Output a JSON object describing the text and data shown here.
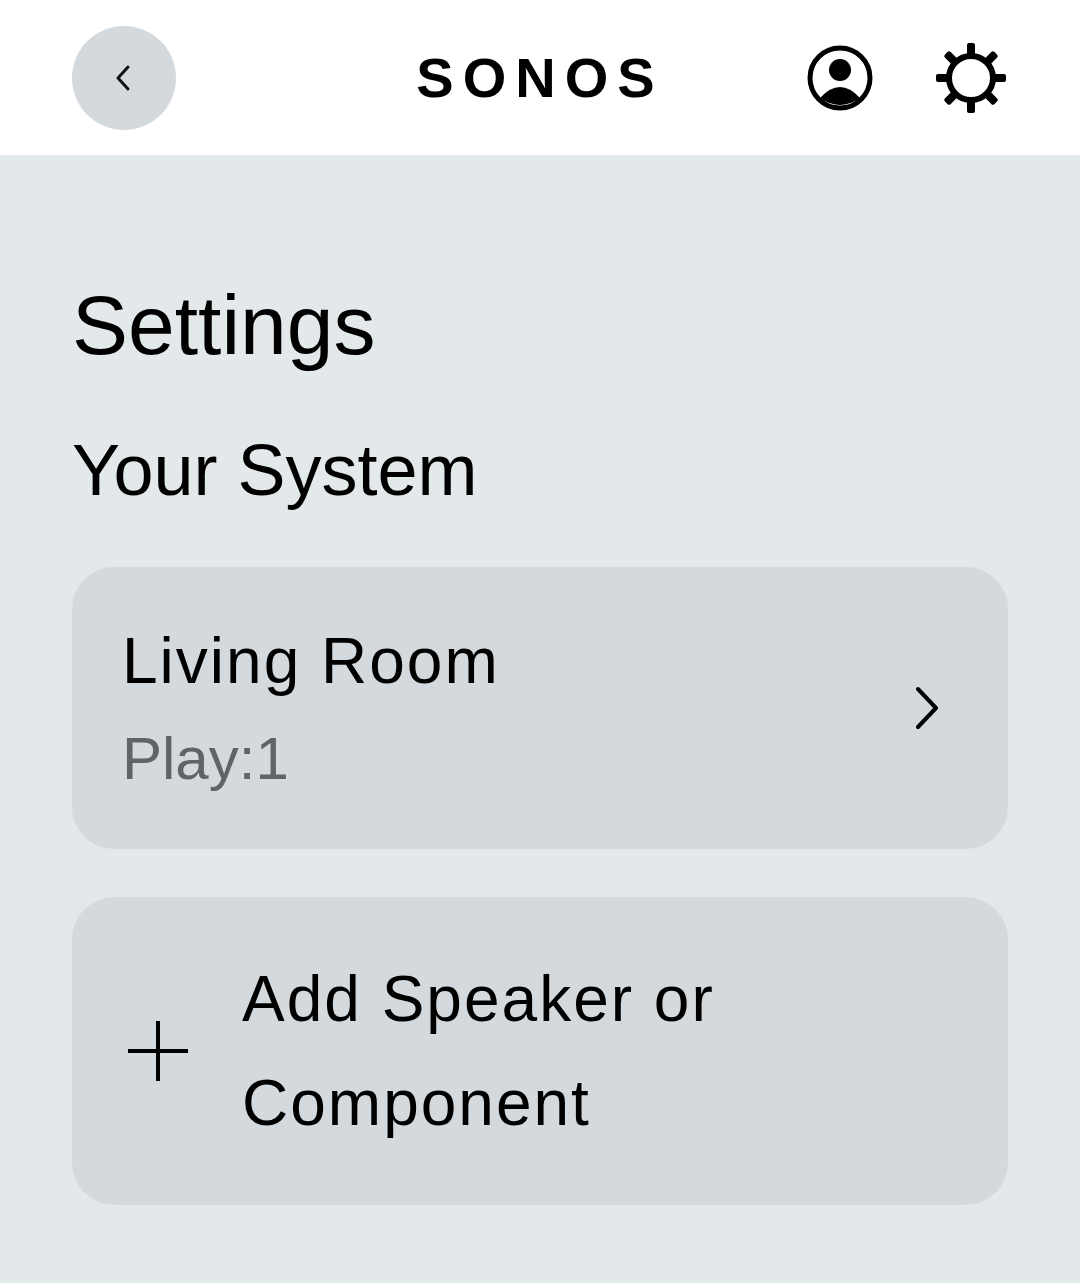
{
  "header": {
    "logo": "SONOS"
  },
  "title": "Settings",
  "section": "Your System",
  "items": [
    {
      "kind": "device",
      "name": "Living Room",
      "model": "Play:1"
    },
    {
      "kind": "add",
      "label": "Add Speaker or Component"
    }
  ]
}
